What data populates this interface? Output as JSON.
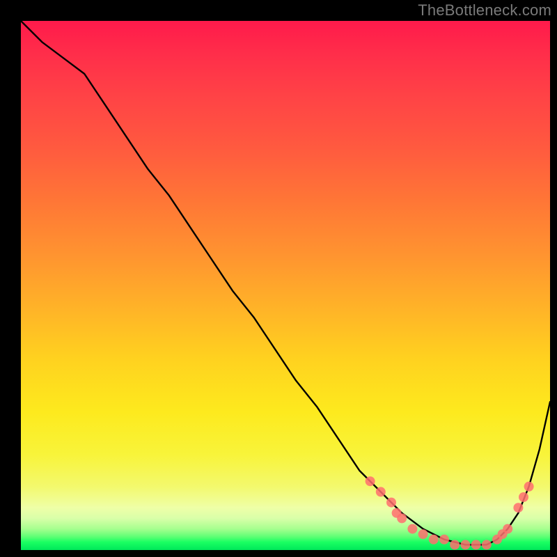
{
  "watermark": {
    "text": "TheBottleneck.com"
  },
  "gradient": {
    "top_color": "#ff1a4b",
    "mid_color": "#ffd21f",
    "bottom_color": "#00e85a"
  },
  "chart_data": {
    "type": "line",
    "title": "",
    "xlabel": "",
    "ylabel": "",
    "xlim": [
      0,
      100
    ],
    "ylim": [
      0,
      100
    ],
    "grid": false,
    "legend": false,
    "series": [
      {
        "name": "curve",
        "color": "#000000",
        "x": [
          0,
          4,
          8,
          12,
          16,
          20,
          24,
          28,
          32,
          36,
          40,
          44,
          48,
          52,
          56,
          60,
          64,
          68,
          70,
          72,
          76,
          80,
          84,
          88,
          90,
          92,
          94,
          96,
          98,
          100
        ],
        "values": [
          100,
          96,
          93,
          90,
          84,
          78,
          72,
          67,
          61,
          55,
          49,
          44,
          38,
          32,
          27,
          21,
          15,
          11,
          9,
          7,
          4,
          2,
          1,
          1,
          2,
          4,
          7,
          12,
          19,
          28
        ]
      }
    ],
    "markers": [
      {
        "name": "dot",
        "color": "#ff6f6f",
        "x": 66,
        "y": 13
      },
      {
        "name": "dot",
        "color": "#ff6f6f",
        "x": 68,
        "y": 11
      },
      {
        "name": "dot",
        "color": "#ff6f6f",
        "x": 70,
        "y": 9
      },
      {
        "name": "dot",
        "color": "#ff6f6f",
        "x": 71,
        "y": 7
      },
      {
        "name": "dot",
        "color": "#ff6f6f",
        "x": 72,
        "y": 6
      },
      {
        "name": "dot",
        "color": "#ff6f6f",
        "x": 74,
        "y": 4
      },
      {
        "name": "dot",
        "color": "#ff6f6f",
        "x": 76,
        "y": 3
      },
      {
        "name": "dot",
        "color": "#ff6f6f",
        "x": 78,
        "y": 2
      },
      {
        "name": "dot",
        "color": "#ff6f6f",
        "x": 80,
        "y": 2
      },
      {
        "name": "dot",
        "color": "#ff6f6f",
        "x": 82,
        "y": 1
      },
      {
        "name": "dot",
        "color": "#ff6f6f",
        "x": 84,
        "y": 1
      },
      {
        "name": "dot",
        "color": "#ff6f6f",
        "x": 86,
        "y": 1
      },
      {
        "name": "dot",
        "color": "#ff6f6f",
        "x": 88,
        "y": 1
      },
      {
        "name": "dot",
        "color": "#ff6f6f",
        "x": 90,
        "y": 2
      },
      {
        "name": "dot",
        "color": "#ff6f6f",
        "x": 91,
        "y": 3
      },
      {
        "name": "dot",
        "color": "#ff6f6f",
        "x": 92,
        "y": 4
      },
      {
        "name": "dot",
        "color": "#ff6f6f",
        "x": 94,
        "y": 8
      },
      {
        "name": "dot",
        "color": "#ff6f6f",
        "x": 95,
        "y": 10
      },
      {
        "name": "dot",
        "color": "#ff6f6f",
        "x": 96,
        "y": 12
      }
    ]
  }
}
